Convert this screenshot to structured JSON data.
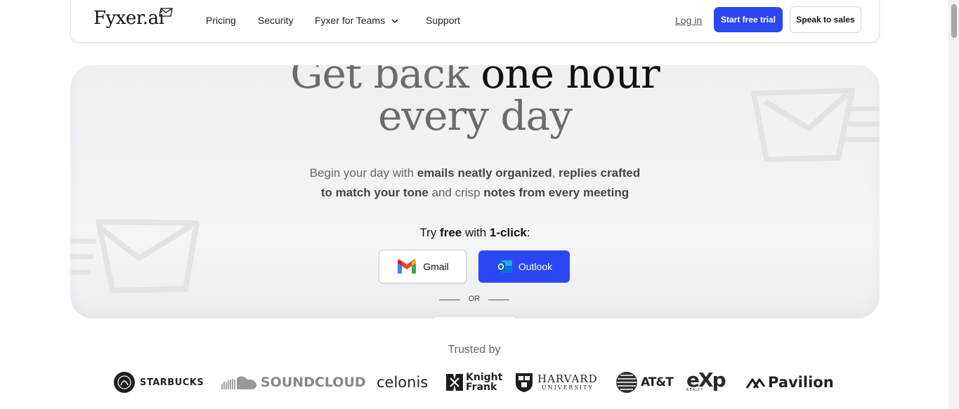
{
  "nav": {
    "logo": "Fyxer.ai",
    "links": [
      "Pricing",
      "Security",
      "Fyxer for Teams",
      "Support"
    ],
    "login": "Log in",
    "start_trial": "Start free trial",
    "speak_sales": "Speak to sales"
  },
  "hero": {
    "headline_line1_light": "Get back",
    "headline_line1_dark": "one hour",
    "headline_line2": "every day",
    "sub_parts": [
      "Begin your day with ",
      "emails neatly organized",
      ", ",
      "replies crafted",
      "to match your tone",
      " and crisp ",
      "notes from every meeting"
    ],
    "try_parts": [
      "Try ",
      "free",
      " with ",
      "1-click",
      ":"
    ],
    "gmail_label": "Gmail",
    "outlook_label": "Outlook",
    "or_label": "OR"
  },
  "trusted": {
    "label": "Trusted by",
    "logos": [
      "STARBUCKS",
      "SOUNDCLOUD",
      "celonis",
      "Knight",
      "Frank",
      "HARVARD",
      "UNIVERSITY",
      "AT&T",
      "eXp",
      "REALTY",
      "Pavilion"
    ]
  },
  "colors": {
    "accent": "#2b46f5"
  }
}
